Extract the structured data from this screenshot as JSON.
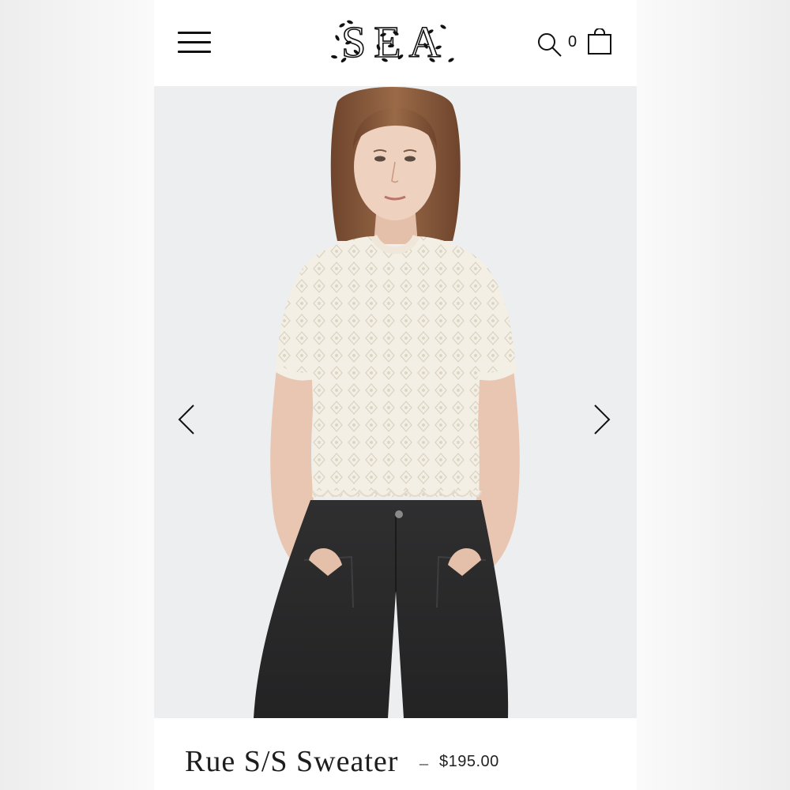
{
  "header": {
    "logo_text": "SEA",
    "menu_icon": "hamburger-menu-icon",
    "search_icon": "search-icon",
    "cart_icon": "shopping-bag-icon",
    "cart_count": "0"
  },
  "gallery": {
    "prev_icon": "chevron-left-icon",
    "next_icon": "chevron-right-icon"
  },
  "product": {
    "name": "Rue S/S Sweater",
    "separator": "–",
    "price": "$195.00"
  },
  "colors": {
    "text": "#1d1d1d",
    "hero_background": "#edeef0",
    "sweater": "#f4efe4",
    "jeans": "#2a2a2b",
    "hair": "#8a5a3c"
  }
}
